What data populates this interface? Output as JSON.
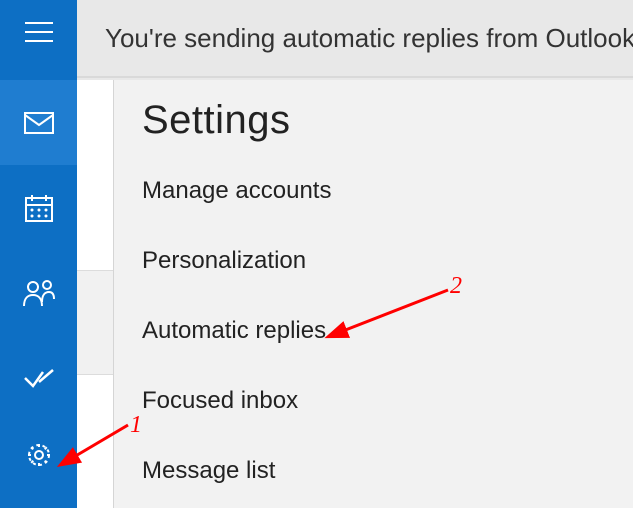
{
  "topbar": {
    "message": "You're sending automatic replies from Outlook"
  },
  "settings": {
    "title": "Settings",
    "items": [
      "Manage accounts",
      "Personalization",
      "Automatic replies",
      "Focused inbox",
      "Message list"
    ]
  },
  "annotations": {
    "label1": "1",
    "label2": "2",
    "color": "#ff0000"
  },
  "sidebar": {
    "items": [
      {
        "name": "mail",
        "active": true
      },
      {
        "name": "calendar",
        "active": false
      },
      {
        "name": "people",
        "active": false
      },
      {
        "name": "todo",
        "active": false
      },
      {
        "name": "settings",
        "active": false
      }
    ]
  }
}
